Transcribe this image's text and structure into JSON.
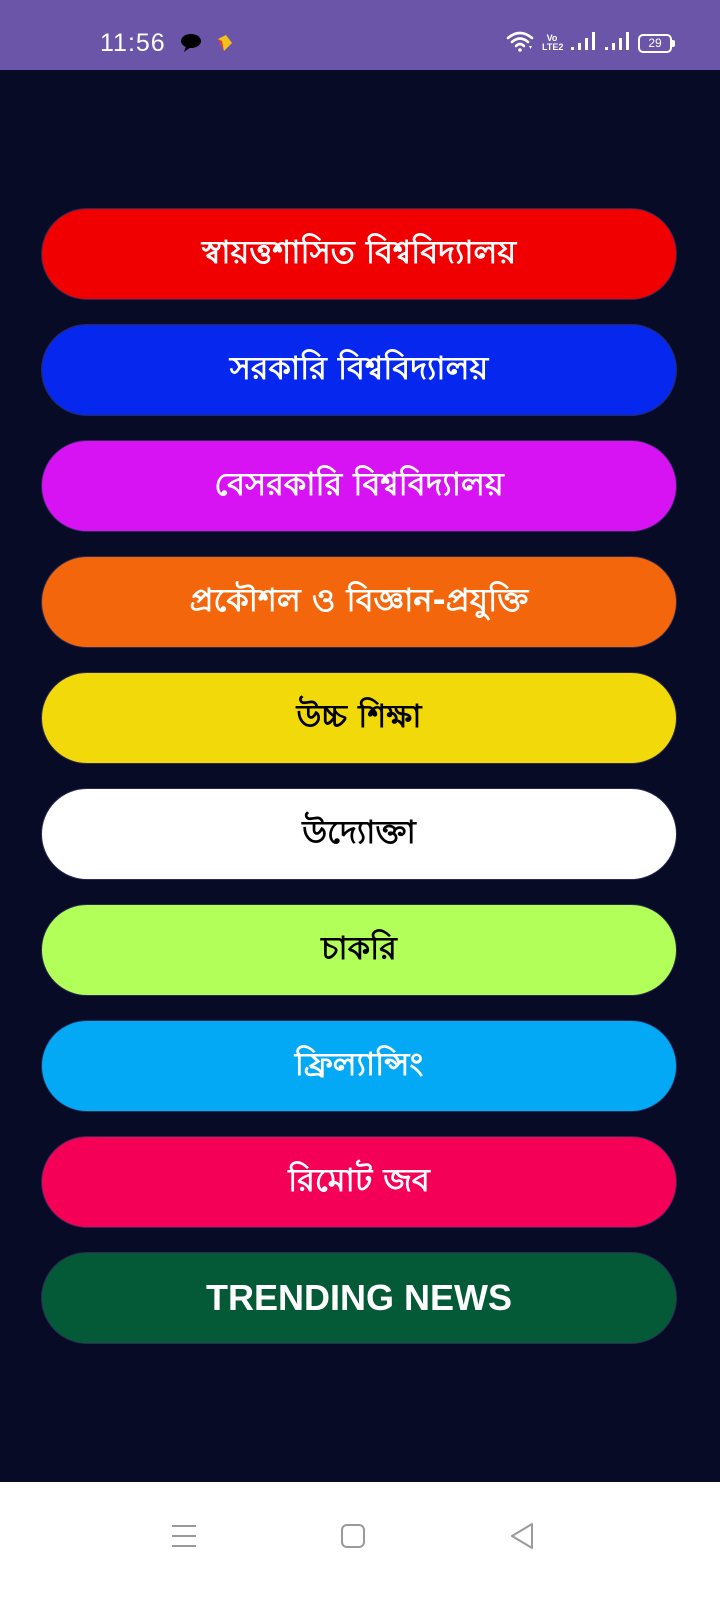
{
  "status_bar": {
    "time": "11:56",
    "battery_level": "29",
    "volte_label_top": "Vo",
    "volte_label_bottom": "LTE2",
    "icons": [
      "message-bubble-icon",
      "app-notification-icon",
      "wifi-icon",
      "volte-icon",
      "signal-strength-icon",
      "signal-strength-icon",
      "battery-icon"
    ]
  },
  "menu": {
    "items": [
      {
        "label": "স্বায়ত্তশাসিত বিশ্ববিদ্যালয়",
        "bg": "#f00000",
        "fg": "#ffffff"
      },
      {
        "label": "সরকারি বিশ্ববিদ্যালয়",
        "bg": "#0627ee",
        "fg": "#ffffff"
      },
      {
        "label": "বেসরকারি বিশ্ববিদ্যালয়",
        "bg": "#d712f3",
        "fg": "#ffffff"
      },
      {
        "label": "প্রকৌশল ও বিজ্ঞান-প্রযুক্তি",
        "bg": "#f4660b",
        "fg": "#ffffff"
      },
      {
        "label": "উচ্চ শিক্ষা",
        "bg": "#f2d90a",
        "fg": "#000000"
      },
      {
        "label": "উদ্যোক্তা",
        "bg": "#ffffff",
        "fg": "#000000"
      },
      {
        "label": "চাকরি",
        "bg": "#b3ff59",
        "fg": "#000000"
      },
      {
        "label": "ফ্রিল্যান্সিং",
        "bg": "#03a9f4",
        "fg": "#ffffff"
      },
      {
        "label": "রিমোট জব",
        "bg": "#f50057",
        "fg": "#ffffff"
      },
      {
        "label": "TRENDING NEWS",
        "bg": "#045a36",
        "fg": "#ffffff"
      }
    ]
  },
  "nav_bar": {
    "icons": [
      "menu-icon",
      "home-icon",
      "back-icon"
    ]
  },
  "colors": {
    "status_bar": "#6a55a8",
    "background": "#080b26",
    "nav_bar": "#ffffff"
  }
}
